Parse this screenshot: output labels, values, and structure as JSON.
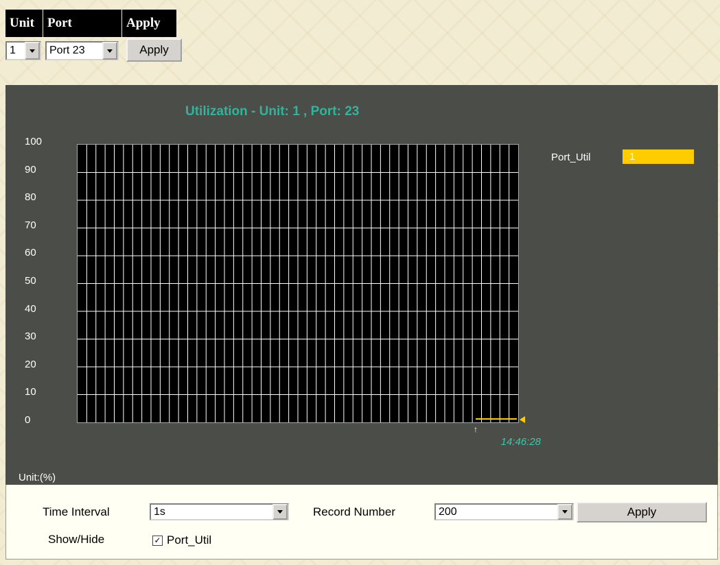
{
  "selector": {
    "headers": {
      "unit": "Unit",
      "port": "Port",
      "apply": "Apply"
    },
    "unit_value": "1",
    "port_value": "Port 23",
    "apply_label": "Apply"
  },
  "chart_data": {
    "type": "line",
    "title": "Utilization - Unit: 1 , Port: 23",
    "ylabel": "Unit:(%)",
    "ylim": [
      0,
      100
    ],
    "y_ticks": [
      "100",
      "90",
      "80",
      "70",
      "60",
      "50",
      "40",
      "30",
      "20",
      "10",
      "0"
    ],
    "grid": true,
    "x_label_time": "14:46:28",
    "series": [
      {
        "name": "Port_Util",
        "color": "#ffcc00",
        "values": [
          1,
          1,
          1,
          1,
          1,
          1,
          1,
          1,
          1,
          1,
          1
        ]
      }
    ],
    "legend": {
      "placement": "right",
      "name": "Port_Util",
      "current_value": "1"
    }
  },
  "controls": {
    "time_interval_label": "Time Interval",
    "time_interval_value": "1s",
    "record_number_label": "Record Number",
    "record_number_value": "200",
    "apply_label": "Apply",
    "show_hide_label": "Show/Hide",
    "checkbox_label": "Port_Util",
    "checkbox_checked": true
  }
}
